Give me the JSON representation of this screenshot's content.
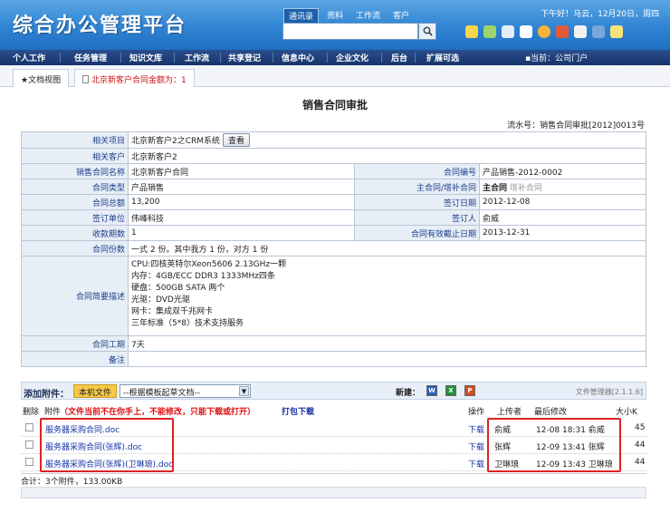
{
  "header": {
    "app_title": "综合办公管理平台",
    "category_tabs": [
      "通讯录",
      "资料",
      "工作流",
      "客户"
    ],
    "greeting": "下午好！马云，12月20日，周四"
  },
  "nav": {
    "items": [
      "个人工作",
      "任务管理",
      "知识文库",
      "工作流",
      "共享登记",
      "信息中心",
      "企业文化",
      "后台",
      "扩展可选"
    ],
    "portal": "▪当前：公司门户"
  },
  "tabs": {
    "doc_view": "★文档视图",
    "alert": "北京新客户合同金额为：1"
  },
  "form": {
    "title": "销售合同审批",
    "serial": "流水号：销售合同审批[2012]0013号",
    "related_project_label": "相关项目",
    "related_project": "北京新客户2之CRM系统",
    "view_button": "查看",
    "related_customer_label": "相关客户",
    "related_customer": "北京新客户2",
    "contract_name_label": "销售合同名称",
    "contract_name": "北京新客户合同",
    "contract_no_label": "合同编号",
    "contract_no": "产品销售-2012-0002",
    "contract_type_label": "合同类型",
    "contract_type": "产品销售",
    "main_contract_label": "主合同/增补合同",
    "main_contract": "主合同",
    "supplement": "增补合同",
    "total_label": "合同总额",
    "total": "13,200",
    "sign_date_label": "签订日期",
    "sign_date": "2012-12-08",
    "sign_unit_label": "签订单位",
    "sign_unit": "伟峰科技",
    "signer_label": "签订人",
    "signer": "俞威",
    "periods_label": "收款期数",
    "periods": "1",
    "expire_label": "合同有效截止日期",
    "expire": "2013-12-31",
    "copies_label": "合同份数",
    "copies": "一式 2 份。其中我方 1 份，对方 1 份",
    "desc_label": "合同简要描述",
    "desc_lines": [
      "CPU:四核英特尔Xeon5606 2.13GHz一颗",
      "内存：4GB/ECC DDR3 1333MHz四条",
      "硬盘：500GB SATA 两个",
      "光驱：DVD光驱",
      "网卡：集成双千兆网卡",
      "三年标准（5*8）技术支持服务"
    ],
    "period_label": "合同工期",
    "period": "7天",
    "remark_label": "备注",
    "remark": ""
  },
  "attachments": {
    "add_label": "添加附件：",
    "local_button": "本机文件",
    "template_select": "--根据模板起草文档--",
    "new_label": "新建：",
    "file_manager": "文件管理器[2.1.1.6]",
    "col_delete": "删除",
    "col_attach": "附件",
    "notice": "（文件当前不在你手上，不能修改，只能下载或打开）",
    "pack_download": "打包下载",
    "col_op": "操作",
    "col_uploader": "上传者",
    "col_modified": "最后修改",
    "col_size": "大小K",
    "rows": [
      {
        "name": "服务器采购合同.doc",
        "op": "下载",
        "uploader": "俞威",
        "modified": "12-08 18:31 俞威",
        "size": "45"
      },
      {
        "name": "服务器采购合同(张辉).doc",
        "op": "下载",
        "uploader": "张辉",
        "modified": "12-09 13:41 张辉",
        "size": "44"
      },
      {
        "name": "服务器采购合同(张辉)(卫琳琅).doc",
        "op": "下载",
        "uploader": "卫琳琅",
        "modified": "12-09 13:43 卫琳琅",
        "size": "44"
      }
    ],
    "total": "合计：3个附件，133.00KB"
  },
  "colors": {
    "header_blue": "#2f84d3",
    "nav_dark": "#17346a",
    "label_blue": "#1a3f8c",
    "highlight_red": "#d22222"
  }
}
